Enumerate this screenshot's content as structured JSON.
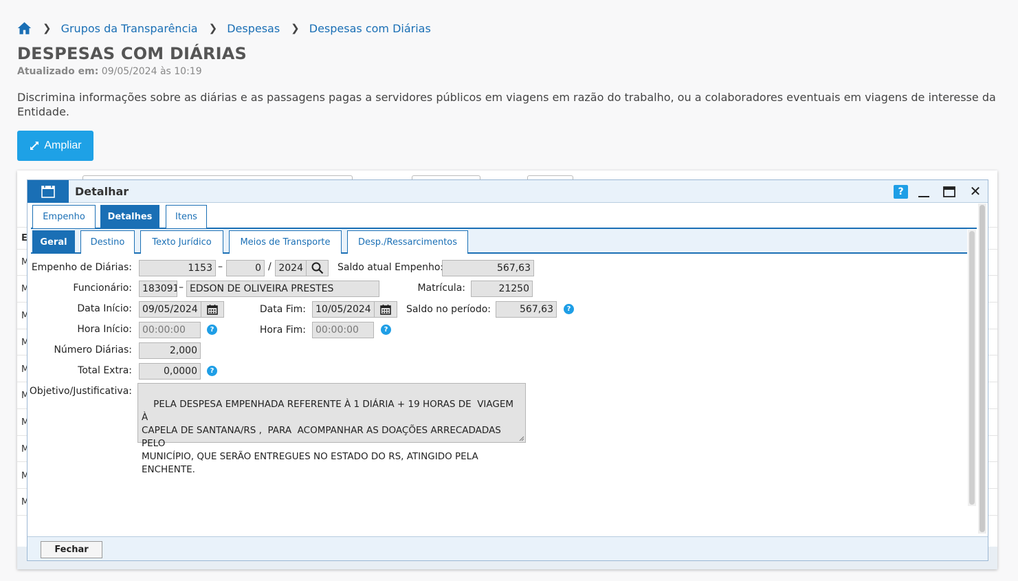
{
  "breadcrumb": {
    "items": [
      "Grupos da Transparência",
      "Despesas",
      "Despesas com Diárias"
    ]
  },
  "page": {
    "title": "DESPESAS COM DIÁRIAS",
    "updated_label": "Atualizado em:",
    "updated_value": "09/05/2024 às 10:19",
    "description": "Discrimina informações sobre as diárias e as passagens pagas a servidores públicos em viagens em razão do trabalho, ou a colaboradores eventuais em viagens de interesse da Entidade.",
    "ampliar_label": "Ampliar"
  },
  "background_grid": {
    "row_letters": [
      "E",
      "M",
      "M",
      "M",
      "M",
      "M",
      "M",
      "M",
      "M",
      "M",
      "M"
    ]
  },
  "dialog": {
    "title": "Detalhar",
    "help_label": "?",
    "close_label": "✕",
    "tabs_main": [
      "Empenho",
      "Detalhes",
      "Itens"
    ],
    "tabs_main_active": "Detalhes",
    "tabs_sub": [
      "Geral",
      "Destino",
      "Texto Jurídico",
      "Meios de Transporte",
      "Desp./Ressarcimentos"
    ],
    "tabs_sub_active": "Geral",
    "footer": {
      "close_button": "Fechar"
    }
  },
  "form": {
    "empenho": {
      "label": "Empenho de Diárias:",
      "numero": "1153",
      "sub": "0",
      "ano": "2024"
    },
    "saldo_atual": {
      "label": "Saldo atual Empenho:",
      "value": "567,63"
    },
    "funcionario": {
      "label": "Funcionário:",
      "codigo": "183091",
      "nome": "EDSON DE OLIVEIRA PRESTES"
    },
    "matricula": {
      "label": "Matrícula:",
      "value": "21250"
    },
    "data_inicio": {
      "label": "Data Início:",
      "value": "09/05/2024"
    },
    "data_fim": {
      "label": "Data Fim:",
      "value": "10/05/2024"
    },
    "saldo_periodo": {
      "label": "Saldo no período:",
      "value": "567,63"
    },
    "hora_inicio": {
      "label": "Hora Início:",
      "value": "00:00:00"
    },
    "hora_fim": {
      "label": "Hora Fim:",
      "value": "00:00:00"
    },
    "numero_diarias": {
      "label": "Número Diárias:",
      "value": "2,000"
    },
    "total_extra": {
      "label": "Total Extra:",
      "value": "0,0000"
    },
    "objetivo": {
      "label": "Objetivo/Justificativa:",
      "value": "PELA DESPESA EMPENHADA REFERENTE À 1 DIÁRIA + 19 HORAS DE  VIAGEM À\nCAPELA DE SANTANA/RS ,  PARA  ACOMPANHAR AS DOAÇÕES ARRECADADAS PELO\nMUNICÍPIO, QUE SERÃO ENTREGUES NO ESTADO DO RS, ATINGIDO PELA ENCHENTE."
    },
    "help_icon": "?",
    "separators": {
      "dash": "–",
      "slash": "/"
    }
  },
  "colors": {
    "primary": "#1a6fb5",
    "accent": "#1ea1e6",
    "field_bg": "#e3e3e3"
  }
}
